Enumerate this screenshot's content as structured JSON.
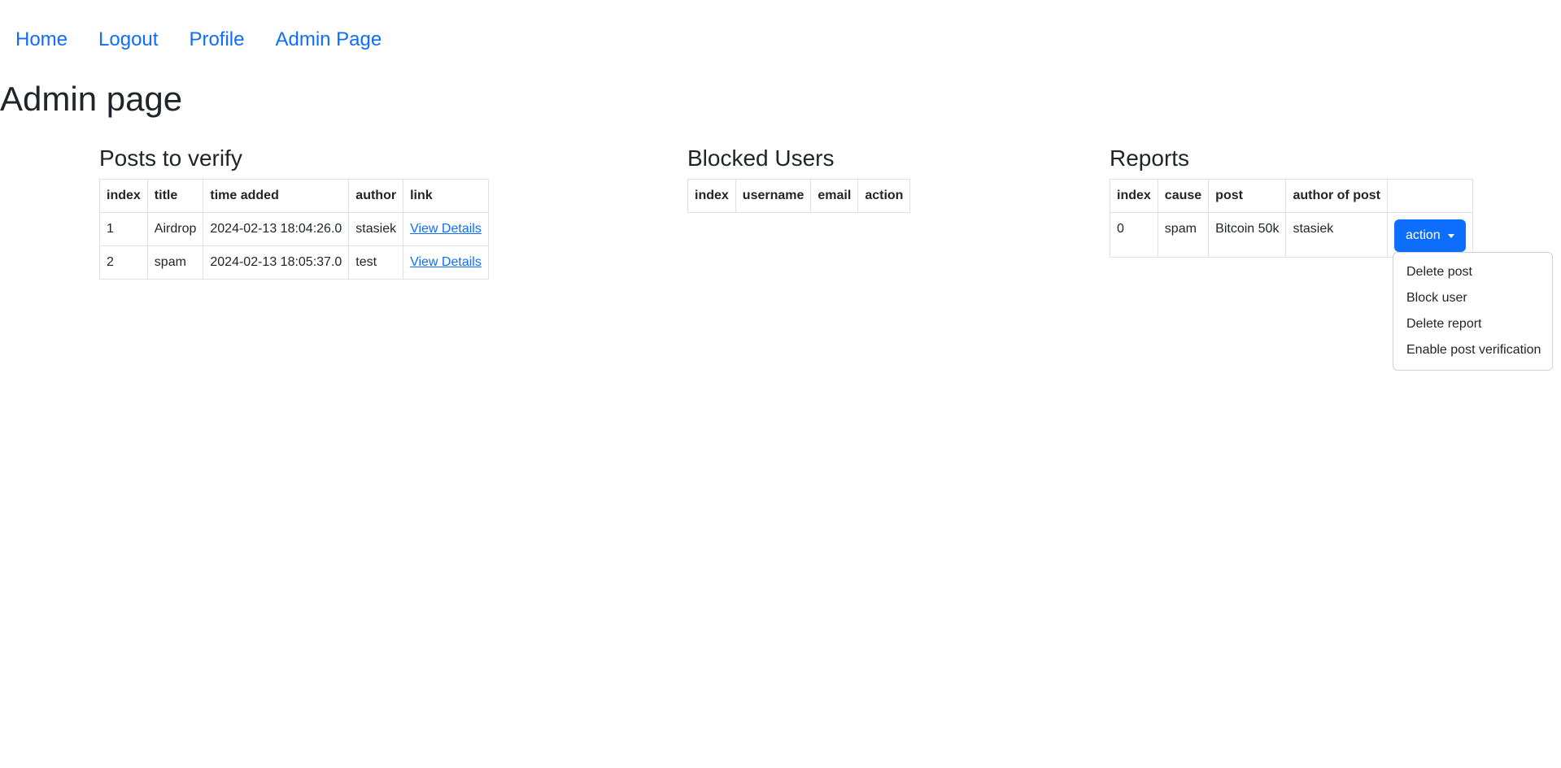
{
  "nav": {
    "items": [
      "Home",
      "Logout",
      "Profile",
      "Admin Page"
    ]
  },
  "page_title": "Admin page",
  "posts": {
    "heading": "Posts to verify",
    "columns": [
      "index",
      "title",
      "time added",
      "author",
      "link"
    ],
    "rows": [
      {
        "index": "1",
        "title": "Airdrop",
        "time": "2024-02-13 18:04:26.0",
        "author": "stasiek",
        "link": "View Details"
      },
      {
        "index": "2",
        "title": "spam",
        "time": "2024-02-13 18:05:37.0",
        "author": "test",
        "link": "View Details"
      }
    ]
  },
  "blocked": {
    "heading": "Blocked Users",
    "columns": [
      "index",
      "username",
      "email",
      "action"
    ]
  },
  "reports": {
    "heading": "Reports",
    "columns": [
      "index",
      "cause",
      "post",
      "author of post",
      ""
    ],
    "rows": [
      {
        "index": "0",
        "cause": "spam",
        "post": "Bitcoin 50k",
        "author": "stasiek",
        "action_label": "action"
      }
    ]
  },
  "dropdown": {
    "items": [
      "Delete post",
      "Block user",
      "Delete report",
      "Enable post verification"
    ]
  },
  "colors": {
    "link": "#0d6efd",
    "button": "#0d6efd",
    "text": "#212529",
    "border": "#dee2e6"
  },
  "icons": {
    "dropdown_caret": "caret-down-icon"
  }
}
